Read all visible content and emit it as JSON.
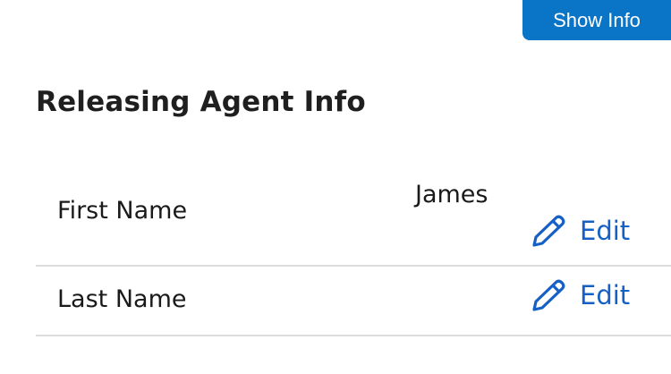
{
  "header": {
    "show_info_label": "Show Info"
  },
  "section": {
    "title": "Releasing Agent Info"
  },
  "rows": [
    {
      "label": "First Name",
      "value": "James",
      "edit_label": "Edit"
    },
    {
      "label": "Last Name",
      "value": "",
      "edit_label": "Edit"
    }
  ],
  "colors": {
    "primary_button": "#0a74c7",
    "link": "#1560c5",
    "divider": "#dcdcdc"
  },
  "icons": {
    "edit": "pencil-icon"
  }
}
